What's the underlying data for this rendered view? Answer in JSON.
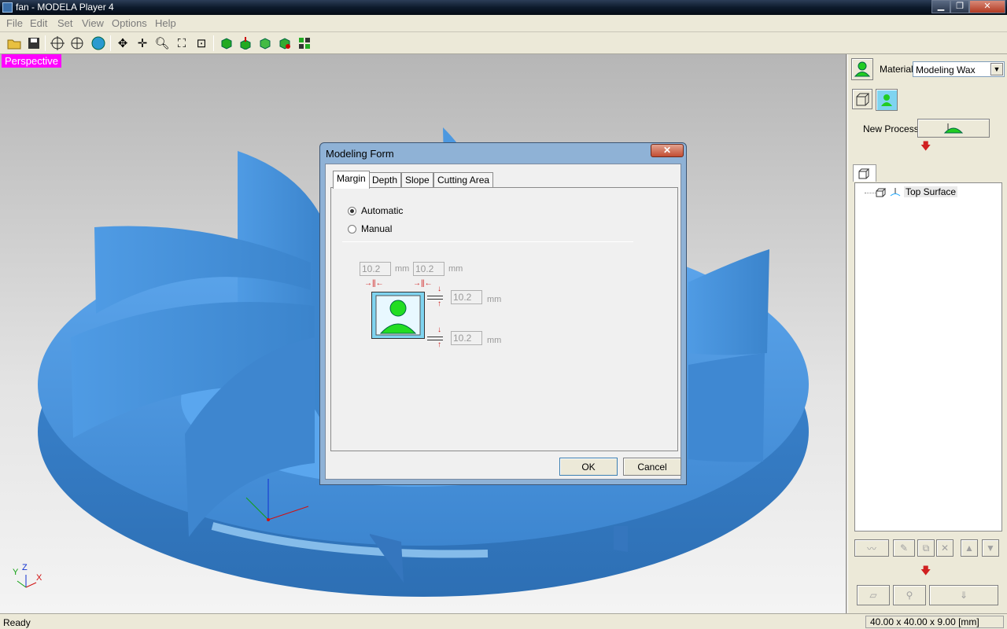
{
  "window": {
    "title": "fan - MODELA Player 4"
  },
  "menu": [
    "File",
    "Edit",
    "Set",
    "View",
    "Options",
    "Help"
  ],
  "viewport": {
    "mode_label": "Perspective"
  },
  "axes": {
    "y": "Y",
    "z": "Z",
    "x": "X"
  },
  "panel": {
    "material_label": "Material",
    "material_value": "Modeling Wax",
    "new_process_label": "New Process",
    "process_item": "Top Surface"
  },
  "dialog": {
    "title": "Modeling Form",
    "close": "✕",
    "tabs": [
      "Margin",
      "Depth",
      "Slope",
      "Cutting Area"
    ],
    "radio_auto": "Automatic",
    "radio_manual": "Manual",
    "margin_left": "10.2",
    "margin_right": "10.2",
    "margin_top": "10.2",
    "margin_bottom": "10.2",
    "unit": "mm",
    "ok": "OK",
    "cancel": "Cancel"
  },
  "status": {
    "left": "Ready",
    "right": "40.00 x 40.00 x 9.00 [mm]"
  },
  "colors": {
    "model": "#4a9ae8",
    "highlight": "#ff00ff",
    "accent_green": "#22cc22"
  }
}
